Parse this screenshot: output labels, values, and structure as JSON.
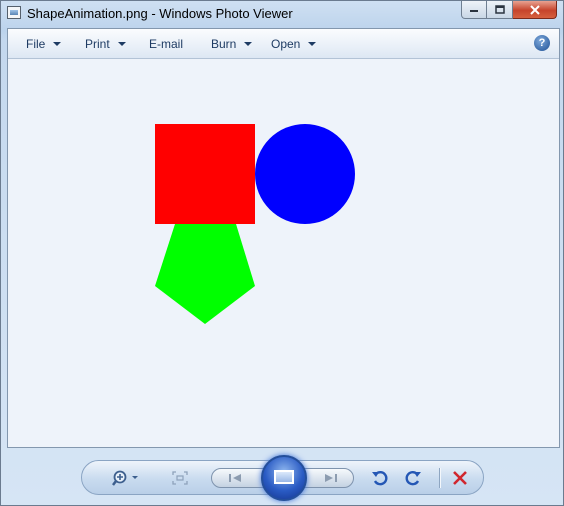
{
  "window": {
    "title": "ShapeAnimation.png - Windows Photo Viewer"
  },
  "menu": {
    "items": [
      {
        "label": "File",
        "has_dropdown": true
      },
      {
        "label": "Print",
        "has_dropdown": true
      },
      {
        "label": "E-mail",
        "has_dropdown": false
      },
      {
        "label": "Burn",
        "has_dropdown": true
      },
      {
        "label": "Open",
        "has_dropdown": true
      }
    ],
    "help_icon": "help-icon"
  },
  "image": {
    "shapes": [
      {
        "name": "square",
        "color": "#ff0000"
      },
      {
        "name": "circle",
        "color": "#0000ff"
      },
      {
        "name": "pentagon",
        "color": "#00ff00"
      }
    ]
  },
  "toolbar": {
    "icons": [
      "zoom-icon",
      "actual-size-icon",
      "previous-icon",
      "slideshow-icon",
      "next-icon",
      "rotate-counterclockwise-icon",
      "rotate-clockwise-icon",
      "delete-icon"
    ]
  },
  "colors": {
    "delete": "#d0262e",
    "rotate": "#2457b5",
    "accent": "#2a5bc4"
  }
}
